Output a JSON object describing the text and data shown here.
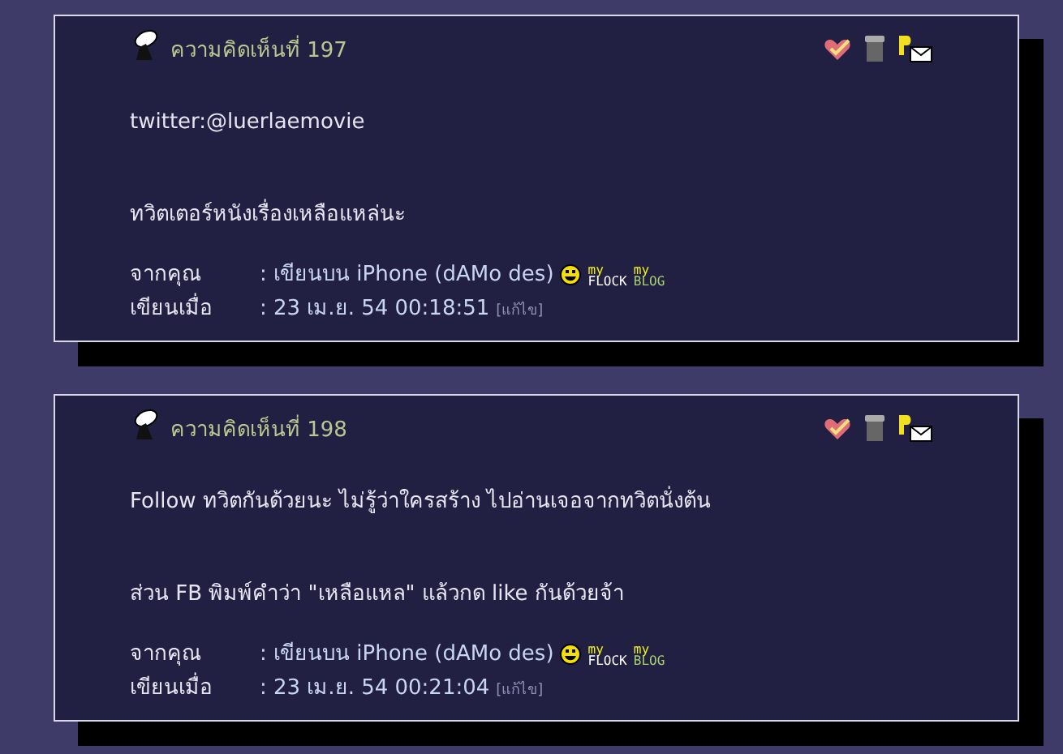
{
  "comments": [
    {
      "title": "ความคิดเห็นที่ 197",
      "paragraphs": [
        "twitter:@luerlaemovie",
        "ทวิตเตอร์หนังเรื่องเหลือแหล่นะ"
      ],
      "from_label": "จากคุณ",
      "author": ": เขียนบน iPhone (dAMo des)",
      "flock": [
        "my",
        "FLOCK"
      ],
      "blog": [
        "my",
        "BLOG"
      ],
      "time_label": "เขียนเมื่อ",
      "date": ": 23 เม.ย. 54 00:18:51",
      "edit": "[แก้ไข]"
    },
    {
      "title": "ความคิดเห็นที่ 198",
      "paragraphs": [
        "Follow ทวิตกันด้วยนะ ไม่รู้ว่าใครสร้าง ไปอ่านเจอจากทวิตนั่งต้น",
        "ส่วน FB พิมพ์คำว่า \"เหลือแหล\" แล้วกด like กันด้วยจ้า"
      ],
      "from_label": "จากคุณ",
      "author": ": เขียนบน iPhone (dAMo des)",
      "flock": [
        "my",
        "FLOCK"
      ],
      "blog": [
        "my",
        "BLOG"
      ],
      "time_label": "เขียนเมื่อ",
      "date": ": 23 เม.ย. 54 00:21:04",
      "edit": "[แก้ไข]"
    }
  ]
}
